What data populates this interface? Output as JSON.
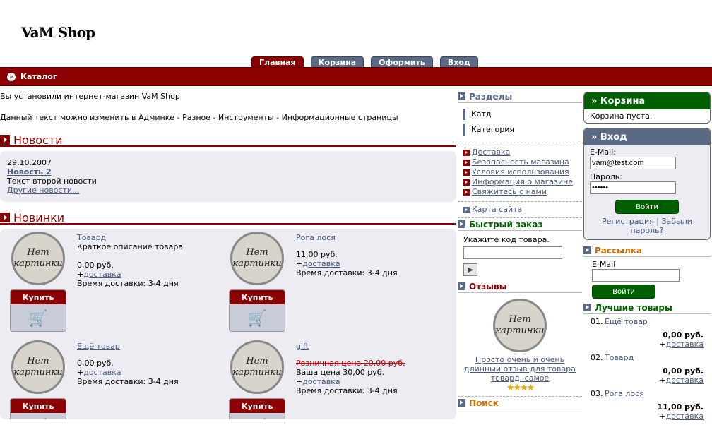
{
  "logo": "VaM Shop",
  "tabs": [
    "Главная",
    "Корзина",
    "Оформить",
    "Вход"
  ],
  "catalog_label": "Каталог",
  "intro": [
    "Вы установили интернет-магазин VaM Shop",
    "Данный текст можно изменить в Админке - Разное - Инструменты - Информационные страницы"
  ],
  "news": {
    "title": "Новости",
    "date": "29.10.2007",
    "item_title": "Новость 2",
    "item_text": "Текст второй новости",
    "more": "Другие новости..."
  },
  "new_products": {
    "title": "Новинки",
    "no_image": "Нет картинки",
    "buy": "Купить",
    "items": [
      {
        "name": "Товард",
        "desc": "Краткое описание товара",
        "price": "0,00 руб.",
        "delivery_prefix": "+",
        "delivery": "доставка",
        "time": "Время доставки:  3-4 дня"
      },
      {
        "name": "Рога лося",
        "desc": "",
        "price": "11,00 руб.",
        "delivery_prefix": "+",
        "delivery": "доставка",
        "time": "Время доставки:  3-4 дня"
      },
      {
        "name": "Ещё товар",
        "desc": "",
        "price": "0,00 руб.",
        "delivery_prefix": "+",
        "delivery": "доставка",
        "time": "Время доставки:  3-4 дня"
      },
      {
        "name": "gift",
        "old_price": "Розничная цена 20,00 руб.",
        "price": "Ваша цена 30,00 руб.",
        "delivery_prefix": "+",
        "delivery": "доставка",
        "time": "Время доставки:  3-4 дня"
      }
    ]
  },
  "sections": {
    "title": "Разделы",
    "categories": [
      "Катд",
      "Категория"
    ],
    "links": [
      "Доставка",
      "Безопасность магазина",
      "Условия использования",
      "Информация о магазине",
      "Свяжитесь с нами"
    ],
    "sitemap": "Карта сайта"
  },
  "quick_order": {
    "title": "Быстрый заказ",
    "label": "Укажите код товара."
  },
  "reviews": {
    "title": "Отзывы",
    "text": "Просто очень и очень длинный отзыв для товара товард, самое"
  },
  "search": {
    "title": "Поиск"
  },
  "cart": {
    "title": "» Корзина",
    "empty": "Корзина пуста."
  },
  "login": {
    "title": "» Вход",
    "email_label": "E-Mail:",
    "email_value": "vam@test.com",
    "password_label": "Пароль:",
    "password_value": "••••••",
    "button": "Войти",
    "register": "Регистрация",
    "sep": " | ",
    "forgot": "Забыли пароль?"
  },
  "newsletter": {
    "title": "Рассылка",
    "email_label": "E-Mail",
    "button": "Войти"
  },
  "best": {
    "title": "Лучшие товары",
    "items": [
      {
        "num": "01.",
        "name": "Ещё товар",
        "price": "0,00 руб.",
        "delivery_prefix": "+",
        "delivery": "доставка"
      },
      {
        "num": "02.",
        "name": "Товард",
        "price": "0,00 руб.",
        "delivery_prefix": "+",
        "delivery": "доставка"
      },
      {
        "num": "03.",
        "name": "Рога лося",
        "price": "11,00 руб.",
        "delivery_prefix": "+",
        "delivery": "доставка"
      }
    ]
  },
  "colors": {
    "brand_red": "#8b0000",
    "slate": "#5a6a85",
    "green": "#006000"
  }
}
